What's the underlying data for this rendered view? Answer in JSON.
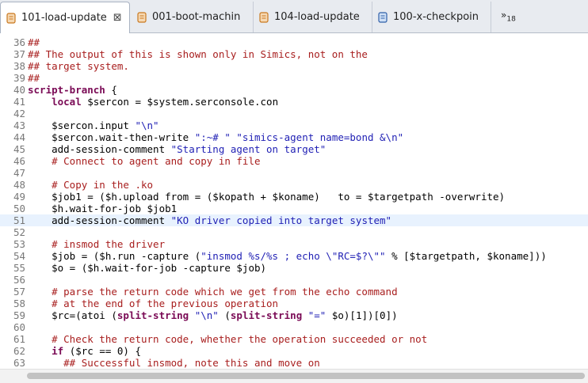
{
  "tabs": [
    {
      "label": "101-load-update",
      "active": true,
      "close": "⊠"
    },
    {
      "label": "001-boot-machin",
      "active": false
    },
    {
      "label": "104-load-update",
      "active": false
    },
    {
      "label": "100-x-checkpoin",
      "active": false
    }
  ],
  "overflow": {
    "chevron": "»",
    "count": "18"
  },
  "lines": [
    {
      "n": "36",
      "t": [
        [
          "c",
          "##"
        ]
      ]
    },
    {
      "n": "37",
      "t": [
        [
          "c",
          "## The output of this is shown only in Simics, not on the"
        ]
      ]
    },
    {
      "n": "38",
      "t": [
        [
          "c",
          "## target system."
        ]
      ]
    },
    {
      "n": "39",
      "t": [
        [
          "c",
          "##"
        ]
      ]
    },
    {
      "n": "40",
      "t": [
        [
          "k",
          "script-branch"
        ],
        [
          "p",
          " {"
        ]
      ]
    },
    {
      "n": "41",
      "t": [
        [
          "p",
          "    "
        ],
        [
          "k",
          "local"
        ],
        [
          "p",
          " $sercon = $system.serconsole.con"
        ]
      ]
    },
    {
      "n": "42",
      "t": []
    },
    {
      "n": "43",
      "t": [
        [
          "p",
          "    $sercon.input "
        ],
        [
          "s",
          "\"\\n\""
        ]
      ]
    },
    {
      "n": "44",
      "t": [
        [
          "p",
          "    $sercon.wait-then-write "
        ],
        [
          "s",
          "\":~# \""
        ],
        [
          "p",
          " "
        ],
        [
          "s",
          "\"simics-agent name=bond &\\n\""
        ]
      ]
    },
    {
      "n": "45",
      "t": [
        [
          "p",
          "    add-session-comment "
        ],
        [
          "s",
          "\"Starting agent on target\""
        ]
      ]
    },
    {
      "n": "46",
      "t": [
        [
          "c",
          "    # Connect to agent and copy in file"
        ]
      ]
    },
    {
      "n": "47",
      "t": []
    },
    {
      "n": "48",
      "t": [
        [
          "c",
          "    # Copy in the .ko"
        ]
      ]
    },
    {
      "n": "49",
      "t": [
        [
          "p",
          "    $job1 = ($h.upload from = ($kopath + $koname)   to = $targetpath -overwrite)"
        ]
      ]
    },
    {
      "n": "50",
      "t": [
        [
          "p",
          "    $h.wait-for-job $job1"
        ]
      ]
    },
    {
      "n": "51",
      "t": [
        [
          "p",
          "    add-session-comment "
        ],
        [
          "s",
          "\"KO driver copied into target system\""
        ]
      ],
      "hl": true
    },
    {
      "n": "52",
      "t": []
    },
    {
      "n": "53",
      "t": [
        [
          "c",
          "    # insmod the driver"
        ]
      ]
    },
    {
      "n": "54",
      "t": [
        [
          "p",
          "    $job = ($h.run -capture ("
        ],
        [
          "s",
          "\"insmod %s/%s ; echo \\\"RC=$?\\\"\""
        ],
        [
          "p",
          " % [$targetpath, $koname]))"
        ]
      ]
    },
    {
      "n": "55",
      "t": [
        [
          "p",
          "    $o = ($h.wait-for-job -capture $job)"
        ]
      ]
    },
    {
      "n": "56",
      "t": []
    },
    {
      "n": "57",
      "t": [
        [
          "c",
          "    # parse the return code which we get from the echo command"
        ]
      ]
    },
    {
      "n": "58",
      "t": [
        [
          "c",
          "    # at the end of the previous operation"
        ]
      ]
    },
    {
      "n": "59",
      "t": [
        [
          "p",
          "    $rc=(atoi ("
        ],
        [
          "k",
          "split-string"
        ],
        [
          "p",
          " "
        ],
        [
          "s",
          "\"\\n\""
        ],
        [
          "p",
          " ("
        ],
        [
          "k",
          "split-string"
        ],
        [
          "p",
          " "
        ],
        [
          "s",
          "\"=\""
        ],
        [
          "p",
          " $o)[1])[0])"
        ]
      ]
    },
    {
      "n": "60",
      "t": []
    },
    {
      "n": "61",
      "t": [
        [
          "c",
          "    # Check the return code, whether the operation succeeded or not"
        ]
      ]
    },
    {
      "n": "62",
      "t": [
        [
          "p",
          "    "
        ],
        [
          "k",
          "if"
        ],
        [
          "p",
          " ($rc == 0) {"
        ]
      ]
    },
    {
      "n": "63",
      "t": [
        [
          "c",
          "      ## Successful insmod, note this and move on"
        ]
      ]
    }
  ],
  "colors": {
    "comment": "#a81e1e",
    "string": "#1f1fb4",
    "keyword": "#7a0a55",
    "current_line": "#e8f2fe"
  }
}
